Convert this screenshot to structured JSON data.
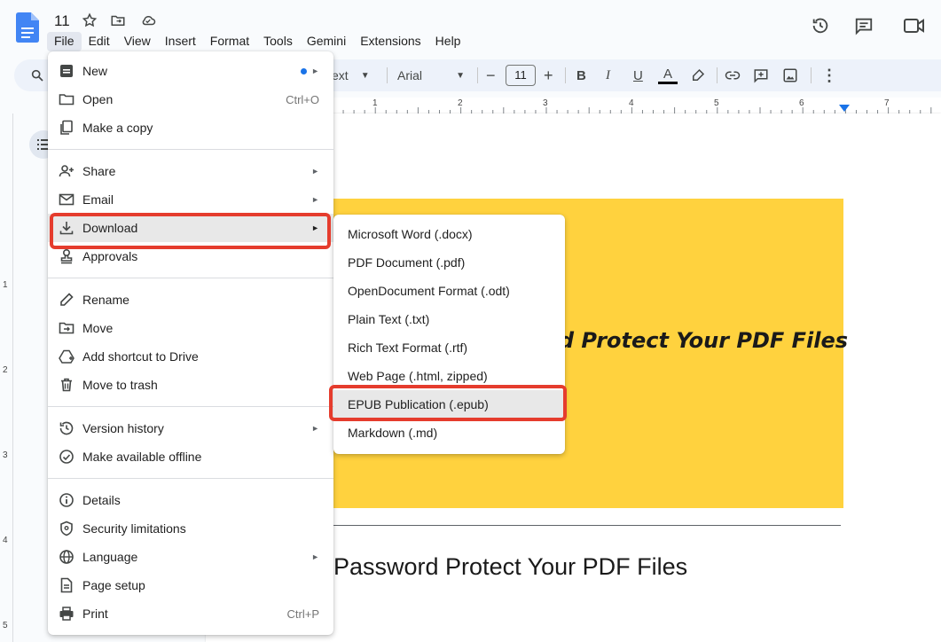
{
  "doc": {
    "title": "11"
  },
  "menubar": [
    "File",
    "Edit",
    "View",
    "Insert",
    "Format",
    "Tools",
    "Gemini",
    "Extensions",
    "Help"
  ],
  "toolbar": {
    "style_partial": "ext",
    "font": "Arial",
    "font_size": "11"
  },
  "ruler": [
    "1",
    "2",
    "3",
    "4",
    "5",
    "6",
    "7"
  ],
  "vruler": [
    "1",
    "2",
    "3",
    "4",
    "5"
  ],
  "document": {
    "banner_text": "rd Protect Your PDF Files",
    "heading": "Password Protect Your PDF Files"
  },
  "file_menu": {
    "new": "New",
    "open": "Open",
    "open_sc": "Ctrl+O",
    "copy": "Make a copy",
    "share": "Share",
    "email": "Email",
    "download": "Download",
    "approvals": "Approvals",
    "rename": "Rename",
    "move": "Move",
    "shortcut": "Add shortcut to Drive",
    "trash": "Move to trash",
    "version": "Version history",
    "offline": "Make available offline",
    "details": "Details",
    "security": "Security limitations",
    "language": "Language",
    "page_setup": "Page setup",
    "print": "Print",
    "print_sc": "Ctrl+P"
  },
  "download_menu": [
    "Microsoft Word (.docx)",
    "PDF Document (.pdf)",
    "OpenDocument Format (.odt)",
    "Plain Text (.txt)",
    "Rich Text Format (.rtf)",
    "Web Page (.html, zipped)",
    "EPUB Publication (.epub)",
    "Markdown (.md)"
  ],
  "colors": {
    "accent": "#1a73e8",
    "highlight": "#e53c2d",
    "banner": "#ffd23e"
  }
}
